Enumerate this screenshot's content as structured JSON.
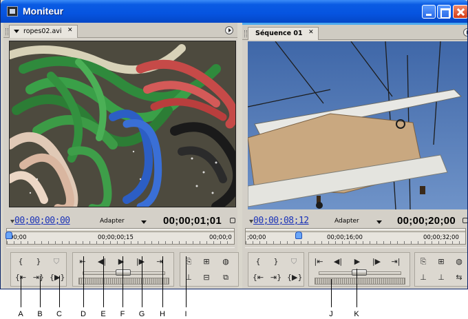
{
  "window": {
    "title": "Moniteur",
    "icon": "film-icon"
  },
  "source": {
    "tab_label": "ropes02.avi",
    "timecode": "00;00;00;00",
    "fit_label": "Adapter",
    "duration": "00;00;01;01",
    "ruler": {
      "start": "00;00",
      "mid": "00;00;00;15",
      "end": "00;00;0"
    }
  },
  "program": {
    "tab_label": "Séquence 01",
    "timecode": "00;00;08;12",
    "fit_label": "Adapter",
    "duration": "00;00;20;00",
    "ruler": {
      "start": ";00;00",
      "mid": "00;00;16;00",
      "end": "00;00;32;00"
    }
  },
  "callouts": [
    "A",
    "B",
    "C",
    "D",
    "E",
    "F",
    "G",
    "H",
    "I",
    "J",
    "K"
  ],
  "colors": {
    "title_bar": "#0a5be3",
    "timecode": "#1b33b8",
    "active_panel": "#4aa8f0"
  }
}
